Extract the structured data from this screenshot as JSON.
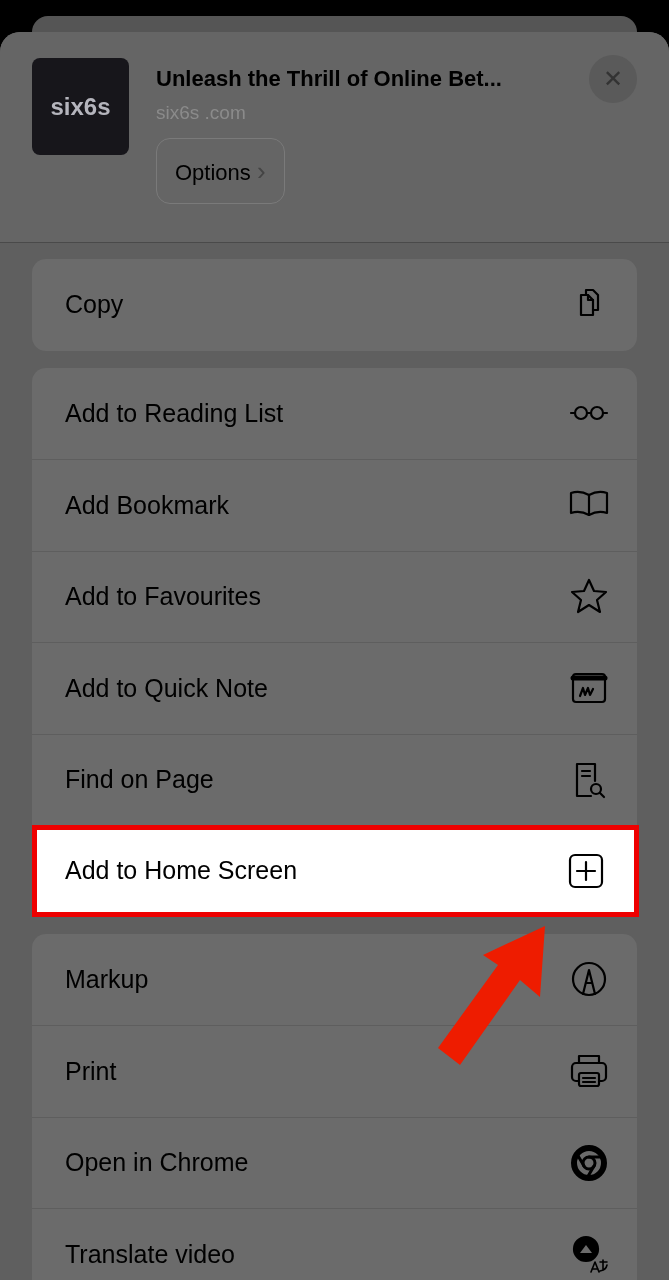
{
  "header": {
    "logo": "six6s",
    "title": "Unleash the Thrill of Online Bet...",
    "url": "six6s .com",
    "options_button": "Options",
    "options_chevron": "›",
    "close": "✕"
  },
  "groups": [
    {
      "items": [
        {
          "label": "Copy",
          "highlighted": false
        }
      ]
    },
    {
      "items": [
        {
          "label": "Add to Reading List",
          "highlighted": false
        },
        {
          "label": "Add Bookmark",
          "highlighted": false
        },
        {
          "label": "Add to Favourites",
          "highlighted": false
        },
        {
          "label": "Add to Quick Note",
          "highlighted": false
        },
        {
          "label": "Find on Page",
          "highlighted": false
        },
        {
          "label": "Add to Home Screen",
          "highlighted": true
        }
      ]
    },
    {
      "items": [
        {
          "label": "Markup",
          "highlighted": false
        },
        {
          "label": "Print",
          "highlighted": false
        },
        {
          "label": "Open in Chrome",
          "highlighted": false
        },
        {
          "label": "Translate video",
          "highlighted": false
        }
      ]
    }
  ]
}
